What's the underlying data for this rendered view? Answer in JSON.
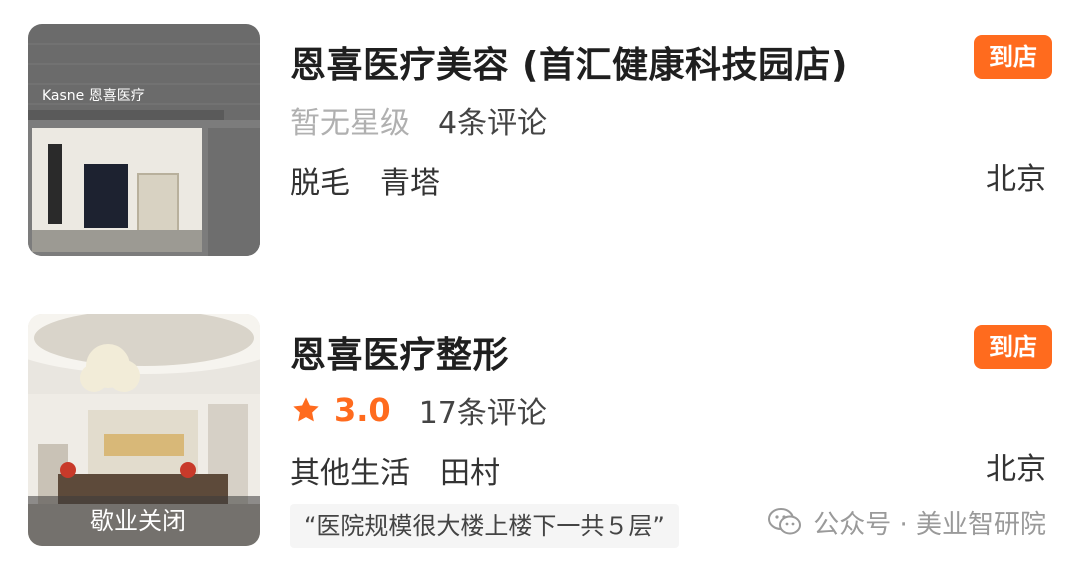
{
  "listings": [
    {
      "title": "恩喜医疗美容 (首汇健康科技园店)",
      "visit_badge": "到店",
      "rating_text": "暂无星级",
      "reviews": "4条评论",
      "tags": [
        "脱毛",
        "青塔"
      ],
      "city": "北京",
      "photo_sign_text": "Kasne 恩喜医疗"
    },
    {
      "title": "恩喜医疗整形",
      "visit_badge": "到店",
      "score": "3.0",
      "reviews": "17条评论",
      "tags": [
        "其他生活",
        "田村"
      ],
      "city": "北京",
      "status_overlay": "歇业关闭",
      "quote": "“医院规模很大楼上楼下一共５层”"
    }
  ],
  "watermark": "公众号 · 美业智研院",
  "colors": {
    "accent": "#ff6b1e",
    "muted": "#b0b0b0",
    "watermark": "#9a9a9a"
  },
  "icons": [
    "star-icon",
    "wechat-icon"
  ]
}
